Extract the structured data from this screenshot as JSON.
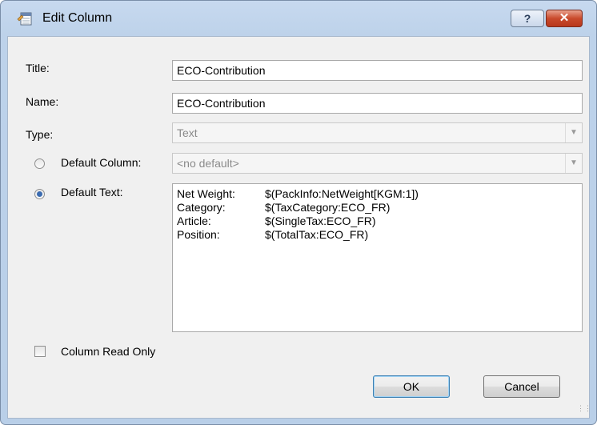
{
  "window": {
    "title": "Edit Column",
    "help_label": "?",
    "close_label": "✕"
  },
  "form": {
    "title_label": "Title:",
    "title_value": "ECO-Contribution",
    "name_label": "Name:",
    "name_value": "ECO-Contribution",
    "type_label": "Type:",
    "type_value": "Text",
    "default_column_label": "Default Column:",
    "default_column_value": "<no default>",
    "default_text_label": "Default Text:",
    "default_text_lines": [
      {
        "key": "Net Weight:",
        "value": "$(PackInfo:NetWeight[KGM:1])"
      },
      {
        "key": "Category:",
        "value": "$(TaxCategory:ECO_FR)"
      },
      {
        "key": "Article:",
        "value": "$(SingleTax:ECO_FR)"
      },
      {
        "key": "Position:",
        "value": "$(TotalTax:ECO_FR)"
      }
    ],
    "read_only_label": "Column Read Only",
    "default_column_selected": false,
    "default_text_selected": true,
    "read_only_checked": false
  },
  "buttons": {
    "ok": "OK",
    "cancel": "Cancel"
  },
  "icons": {
    "title": "edit-column-icon",
    "combo_arrow": "chevron-down-icon"
  }
}
